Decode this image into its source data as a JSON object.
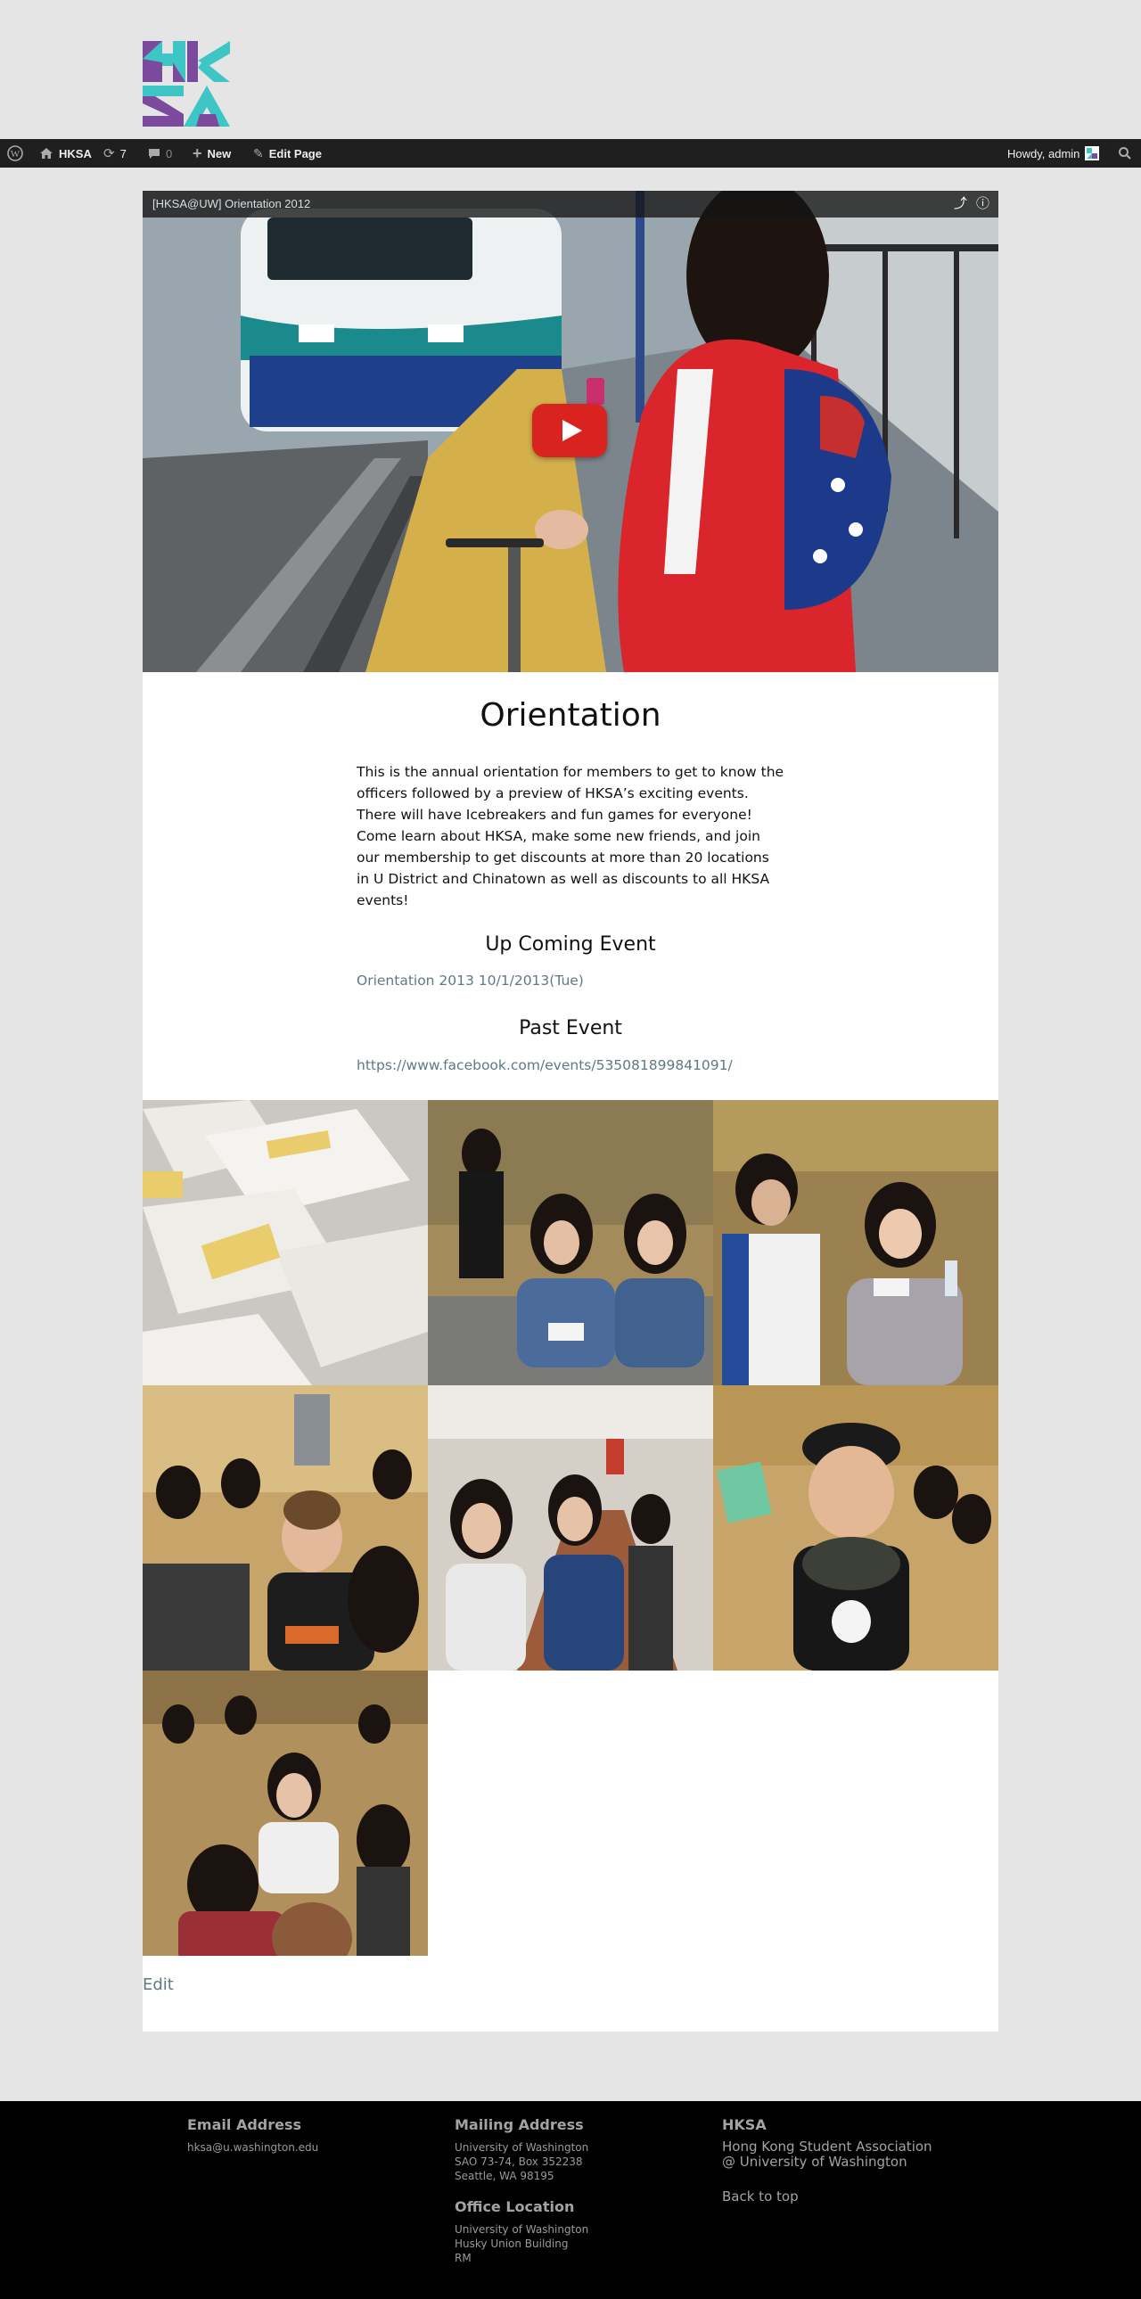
{
  "site": {
    "logo_text": "HKSA"
  },
  "adminbar": {
    "site_name": "HKSA",
    "updates_count": "7",
    "comments_count": "0",
    "new_label": "New",
    "edit_page_label": "Edit Page",
    "howdy": "Howdy, admin"
  },
  "video": {
    "title": "[HKSA@UW] Orientation 2012"
  },
  "page": {
    "title": "Orientation",
    "intro": "This is the annual orientation for members to get to know the officers followed by a preview of HKSA’s exciting events. There will have Icebreakers and fun games for everyone! Come learn about HKSA, make some new friends, and join our membership to get discounts at more than 20 locations in U District and Chinatown as well as discounts to all HKSA events!",
    "upcoming_heading": "Up Coming Event",
    "upcoming_link": "Orientation 2013 10/1/2013(Tue)",
    "past_heading": "Past Event",
    "past_link": "https://www.facebook.com/events/535081899841091/",
    "edit_link": "Edit"
  },
  "footer": {
    "email_heading": "Email Address",
    "email": "hksa@u.washington.edu",
    "mailing_heading": "Mailing Address",
    "mailing_lines": [
      "University of Washington",
      "SAO 73-74, Box 352238",
      "Seattle, WA 98195"
    ],
    "office_heading": "Office Location",
    "office_lines": [
      "University of Washington",
      "Husky Union Building",
      "RM"
    ],
    "org_heading": "HKSA",
    "org_name_1": "Hong Kong Student Association",
    "org_name_2": "@ University of Washington",
    "back_to_top": "Back to top"
  },
  "colors": {
    "accent_teal": "#5f7a7e",
    "logo_teal": "#3ec6c6",
    "logo_purple": "#7c4a9c",
    "adminbar_bg": "#1f1f1f",
    "youtube_red": "#d8231f"
  }
}
